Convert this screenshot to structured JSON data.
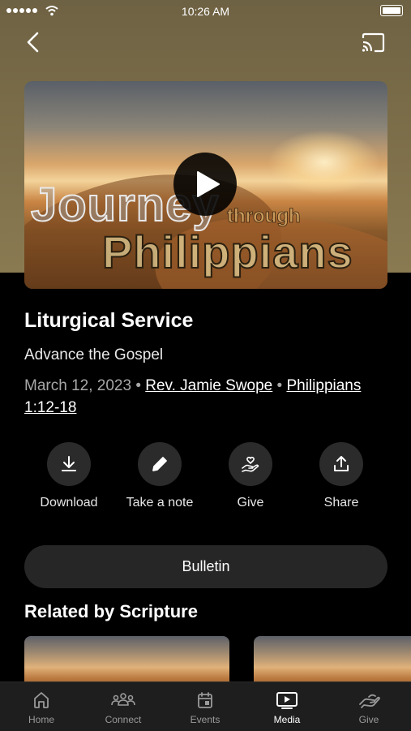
{
  "status_bar": {
    "time": "10:26 AM"
  },
  "hero": {
    "title_line1": "Journey",
    "title_line2": "through",
    "title_line3": "Philippians"
  },
  "sermon": {
    "title": "Liturgical Service",
    "subtitle": "Advance the Gospel",
    "date": "March 12, 2023",
    "separator": "•",
    "speaker": "Rev. Jamie Swope",
    "scripture": "Philippians 1:12-18"
  },
  "actions": [
    {
      "label": "Download",
      "icon": "download-icon"
    },
    {
      "label": "Take a note",
      "icon": "pencil-icon"
    },
    {
      "label": "Give",
      "icon": "give-hand-heart-icon"
    },
    {
      "label": "Share",
      "icon": "share-icon"
    }
  ],
  "bulletin_label": "Bulletin",
  "related": {
    "title": "Related by Scripture"
  },
  "tabs": [
    {
      "label": "Home",
      "icon": "home-icon",
      "active": false
    },
    {
      "label": "Connect",
      "icon": "people-icon",
      "active": false
    },
    {
      "label": "Events",
      "icon": "calendar-icon",
      "active": false
    },
    {
      "label": "Media",
      "icon": "media-icon",
      "active": true
    },
    {
      "label": "Give",
      "icon": "give-icon",
      "active": false
    }
  ],
  "colors": {
    "header_bg": "#7a6c48",
    "background": "#000000",
    "button_bg": "#2b2b2b"
  }
}
